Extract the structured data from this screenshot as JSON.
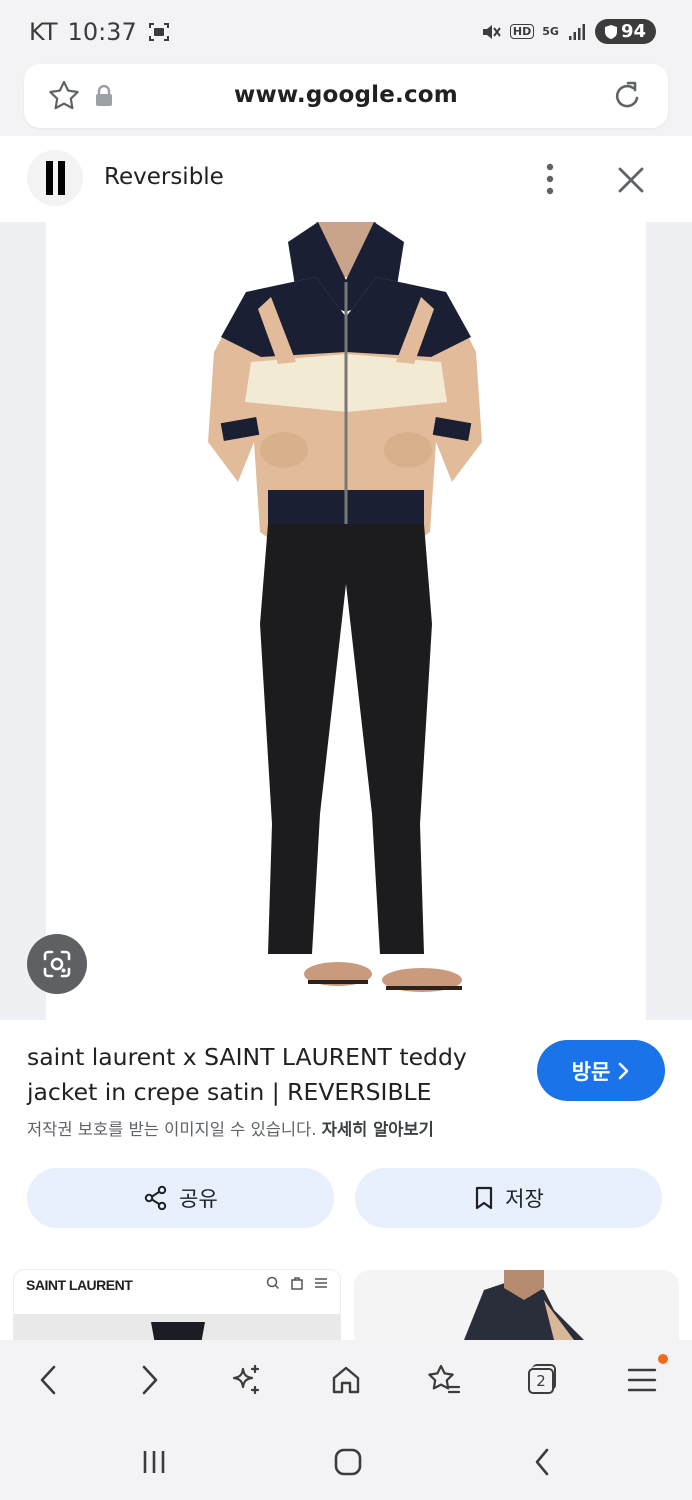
{
  "status": {
    "carrier": "KT",
    "time": "10:37",
    "network": "5G",
    "hd": "HD",
    "battery": "94"
  },
  "browser": {
    "url": "www.google.com",
    "tab_count": "2"
  },
  "header": {
    "title": "Reversible"
  },
  "result": {
    "title": "saint laurent x SAINT LAURENT teddy jacket in crepe satin | REVERSIBLE",
    "visit_label": "방문",
    "copyright_text": "저작권 보호를 받는 이미지일 수 있습니다.",
    "learn_more": "자세히 알아보기",
    "share_label": "공유",
    "save_label": "저장"
  },
  "related": {
    "thumb1_brand": "SAINT LAURENT"
  },
  "colors": {
    "accent": "#1a73e8",
    "chip_bg": "#e8f0fe",
    "notification": "#f36a1c"
  },
  "icons": [
    "star-icon",
    "lock-icon",
    "reload-icon",
    "more-vert-icon",
    "close-icon",
    "lens-icon",
    "share-icon",
    "bookmark-icon",
    "back-icon",
    "forward-icon",
    "sparkle-icon",
    "home-icon",
    "bookmarks-icon",
    "tabs-icon",
    "menu-icon"
  ]
}
